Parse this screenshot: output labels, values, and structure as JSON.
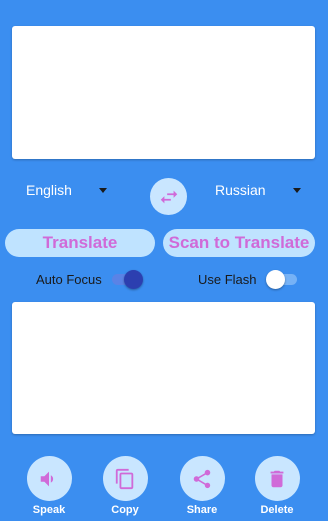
{
  "source_language": {
    "selected": "English"
  },
  "target_language": {
    "selected": "Russian"
  },
  "buttons": {
    "translate": "Translate",
    "scan": "Scan to Translate"
  },
  "toggles": {
    "auto_focus": {
      "label": "Auto Focus",
      "on": true
    },
    "use_flash": {
      "label": "Use Flash",
      "on": false
    }
  },
  "actions": [
    {
      "label": "Speak",
      "icon": "speaker-icon"
    },
    {
      "label": "Copy",
      "icon": "copy-icon"
    },
    {
      "label": "Share",
      "icon": "share-icon"
    },
    {
      "label": "Delete",
      "icon": "trash-icon"
    }
  ],
  "colors": {
    "background": "#3b8ef0",
    "button_fill": "#bfe3ff",
    "button_text": "#d06ad8",
    "icon": "#d06ad8",
    "switch_on": "#2c3fb0"
  }
}
